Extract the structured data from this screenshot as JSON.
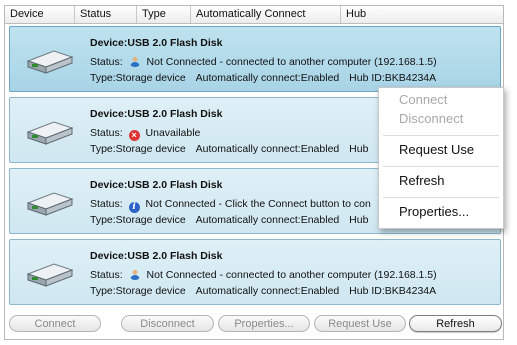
{
  "columns": [
    "Device",
    "Status",
    "Type",
    "Automatically Connect",
    "Hub"
  ],
  "devices": [
    {
      "name": "Device:USB 2.0 Flash Disk",
      "status_label": "Status:",
      "status_icon": "user-icon",
      "status_text": "Not Connected - connected to another computer (192.168.1.5)",
      "type_text": "Type:Storage device",
      "auto_text": "Automatically connect:Enabled",
      "hub_text": "Hub ID:BKB4234A"
    },
    {
      "name": "Device:USB 2.0 Flash Disk",
      "status_label": "Status:",
      "status_icon": "error-icon",
      "status_text": "Unavailable",
      "type_text": "Type:Storage device",
      "auto_text": "Automatically connect:Enabled",
      "hub_text": "Hub"
    },
    {
      "name": "Device:USB 2.0 Flash Disk",
      "status_label": "Status:",
      "status_icon": "info-icon",
      "status_text": "Not Connected - Click the Connect button to con",
      "type_text": "Type:Storage device",
      "auto_text": "Automatically connect:Enabled",
      "hub_text": "Hub"
    },
    {
      "name": "Device:USB 2.0 Flash Disk",
      "status_label": "Status:",
      "status_icon": "user-icon",
      "status_text": "Not Connected - connected to another computer (192.168.1.5)",
      "type_text": "Type:Storage device",
      "auto_text": "Automatically connect:Enabled",
      "hub_text": "Hub ID:BKB4234A"
    }
  ],
  "context_menu": {
    "connect": "Connect",
    "disconnect": "Disconnect",
    "request_use": "Request Use",
    "refresh": "Refresh",
    "properties": "Properties..."
  },
  "buttons": {
    "connect": "Connect",
    "disconnect": "Disconnect",
    "properties": "Properties...",
    "request_use": "Request Use",
    "refresh": "Refresh"
  },
  "colors": {
    "row_selected": "#a8d4e6",
    "row_normal": "#d4eaf2",
    "error": "#d33333",
    "info": "#2d63c8"
  }
}
